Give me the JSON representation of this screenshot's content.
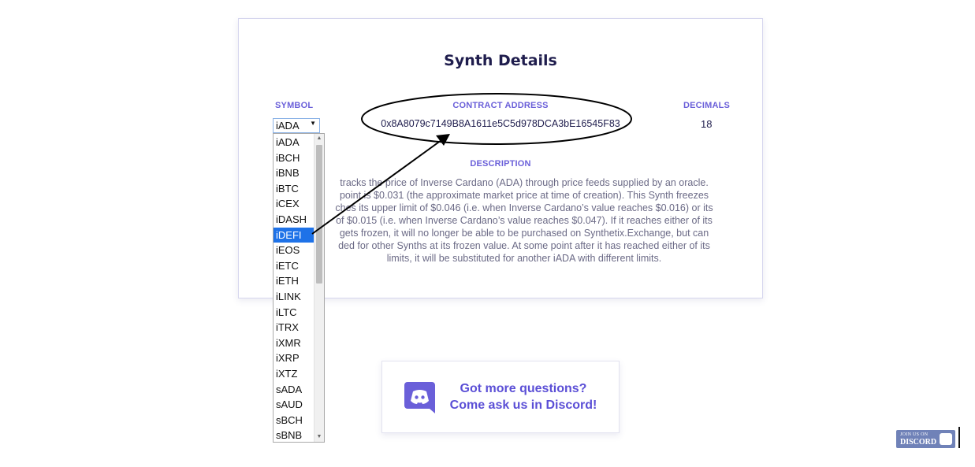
{
  "card": {
    "title": "Synth Details",
    "symbol_label": "SYMBOL",
    "address_label": "CONTRACT ADDRESS",
    "decimals_label": "DECIMALS",
    "address_value": "0x8A8079c7149B8A1611e5C5d978DCA3bE16545F83",
    "decimals_value": "18",
    "description_label": "DESCRIPTION",
    "description_lines": [
      "tracks the price of Inverse Cardano (ADA) through price feeds supplied by an oracle.",
      "point is $0.031 (the approximate market price at time of creation). This Synth freezes",
      "ches its upper limit of $0.046 (i.e. when Inverse Cardano’s value reaches $0.016) or its",
      "of $0.015 (i.e. when Inverse Cardano’s value reaches $0.047). If it reaches either of its",
      "gets frozen, it will no longer be able to be purchased on Synthetix.Exchange, but can",
      "ded for other Synths at its frozen value. At some point after it has reached either of its",
      "limits, it will be substituted for another iADA with different limits."
    ]
  },
  "symbol_select": {
    "selected_value": "iADA",
    "highlighted": "iDEFI",
    "options": [
      "iADA",
      "iBCH",
      "iBNB",
      "iBTC",
      "iCEX",
      "iDASH",
      "iDEFI",
      "iEOS",
      "iETC",
      "iETH",
      "iLINK",
      "iLTC",
      "iTRX",
      "iXMR",
      "iXRP",
      "iXTZ",
      "sADA",
      "sAUD",
      "sBCH",
      "sBNB"
    ]
  },
  "discord_card": {
    "line1": "Got more questions?",
    "line2": "Come ask us in Discord!"
  },
  "join_badge": {
    "top": "JOIN US ON",
    "bottom": "DISCORD"
  },
  "colors": {
    "accent": "#6a5fd9",
    "discord": "#5b4fd6",
    "selection": "#1e72e8"
  }
}
